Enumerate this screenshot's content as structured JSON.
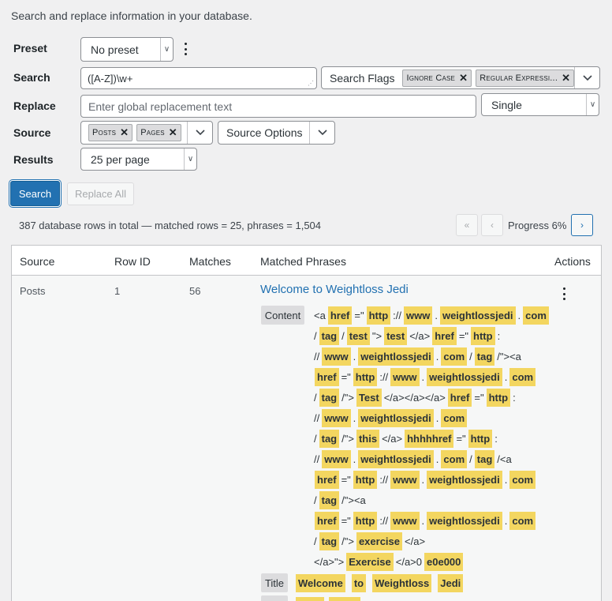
{
  "intro": "Search and replace information in your database.",
  "labels": {
    "preset": "Preset",
    "search": "Search",
    "replace": "Replace",
    "source": "Source",
    "results": "Results"
  },
  "preset": {
    "value": "No preset"
  },
  "search": {
    "value": "([A-Z])\\w+"
  },
  "search_flags": {
    "label": "Search Flags",
    "tags": [
      "Ignore Case",
      "Regular Expressi..."
    ]
  },
  "replace": {
    "placeholder": "Enter global replacement text",
    "mode": "Single"
  },
  "source": {
    "tags": [
      "Posts",
      "Pages"
    ],
    "options_label": "Source Options"
  },
  "results": {
    "value": "25 per page"
  },
  "buttons": {
    "search": "Search",
    "replace_all": "Replace All"
  },
  "summary": "387 database rows in total — matched rows = 25, phrases = 1,504",
  "pagination": {
    "first": "«",
    "prev": "‹",
    "progress": "Progress 6%",
    "next": "›"
  },
  "progress_percent": 6,
  "colors": {
    "primary": "#2271b1",
    "highlight": "#f3d660",
    "link": "#2271b1"
  },
  "table": {
    "headers": [
      "Source",
      "Row ID",
      "Matches",
      "Matched Phrases",
      "Actions"
    ],
    "rows": [
      {
        "source": "Posts",
        "row_id": "1",
        "matches": "56",
        "title": "Welcome to Weightloss Jedi",
        "content_label": "Content",
        "title_label": "Title",
        "content_lines": [
          [
            [
              "p",
              "<a"
            ],
            [
              "h",
              "href"
            ],
            [
              "p",
              "=\""
            ],
            [
              "h",
              "http"
            ],
            [
              "p",
              "://"
            ],
            [
              "h",
              "www"
            ],
            [
              "p",
              "."
            ],
            [
              "h",
              "weightlossjedi"
            ],
            [
              "p",
              "."
            ],
            [
              "h",
              "com"
            ]
          ],
          [
            [
              "p",
              "/"
            ],
            [
              "h",
              "tag"
            ],
            [
              "p",
              "/"
            ],
            [
              "h",
              "test"
            ],
            [
              "p",
              "\">"
            ],
            [
              "h",
              "test"
            ],
            [
              "p",
              "</a>"
            ],
            [
              "h",
              "href"
            ],
            [
              "p",
              "=\""
            ],
            [
              "h",
              "http"
            ],
            [
              "p",
              ":"
            ]
          ],
          [
            [
              "p",
              "//"
            ],
            [
              "h",
              "www"
            ],
            [
              "p",
              "."
            ],
            [
              "h",
              "weightlossjedi"
            ],
            [
              "p",
              "."
            ],
            [
              "h",
              "com"
            ],
            [
              "p",
              "/"
            ],
            [
              "h",
              "tag"
            ],
            [
              "p",
              "/\"><a"
            ]
          ],
          [
            [
              "h",
              "href"
            ],
            [
              "p",
              "=\""
            ],
            [
              "h",
              "http"
            ],
            [
              "p",
              "://"
            ],
            [
              "h",
              "www"
            ],
            [
              "p",
              "."
            ],
            [
              "h",
              "weightlossjedi"
            ],
            [
              "p",
              "."
            ],
            [
              "h",
              "com"
            ]
          ],
          [
            [
              "p",
              "/"
            ],
            [
              "h",
              "tag"
            ],
            [
              "p",
              "/\">"
            ],
            [
              "h",
              "Test"
            ],
            [
              "p",
              "</a></a></a>"
            ],
            [
              "h",
              "href"
            ],
            [
              "p",
              "=\""
            ],
            [
              "h",
              "http"
            ],
            [
              "p",
              ":"
            ]
          ],
          [
            [
              "p",
              "//"
            ],
            [
              "h",
              "www"
            ],
            [
              "p",
              "."
            ],
            [
              "h",
              "weightlossjedi"
            ],
            [
              "p",
              "."
            ],
            [
              "h",
              "com"
            ]
          ],
          [
            [
              "p",
              "/"
            ],
            [
              "h",
              "tag"
            ],
            [
              "p",
              "/\">"
            ],
            [
              "h",
              "this"
            ],
            [
              "p",
              "</a>"
            ],
            [
              "h",
              "hhhhhref"
            ],
            [
              "p",
              "=\""
            ],
            [
              "h",
              "http"
            ],
            [
              "p",
              ":"
            ]
          ],
          [
            [
              "p",
              "//"
            ],
            [
              "h",
              "www"
            ],
            [
              "p",
              "."
            ],
            [
              "h",
              "weightlossjedi"
            ],
            [
              "p",
              "."
            ],
            [
              "h",
              "com"
            ],
            [
              "p",
              "/"
            ],
            [
              "h",
              "tag"
            ],
            [
              "p",
              "/<a"
            ]
          ],
          [
            [
              "h",
              "href"
            ],
            [
              "p",
              "=\""
            ],
            [
              "h",
              "http"
            ],
            [
              "p",
              "://"
            ],
            [
              "h",
              "www"
            ],
            [
              "p",
              "."
            ],
            [
              "h",
              "weightlossjedi"
            ],
            [
              "p",
              "."
            ],
            [
              "h",
              "com"
            ]
          ],
          [
            [
              "p",
              "/"
            ],
            [
              "h",
              "tag"
            ],
            [
              "p",
              "/\"><a"
            ]
          ],
          [
            [
              "h",
              "href"
            ],
            [
              "p",
              "=\""
            ],
            [
              "h",
              "http"
            ],
            [
              "p",
              "://"
            ],
            [
              "h",
              "www"
            ],
            [
              "p",
              "."
            ],
            [
              "h",
              "weightlossjedi"
            ],
            [
              "p",
              "."
            ],
            [
              "h",
              "com"
            ]
          ],
          [
            [
              "p",
              "/"
            ],
            [
              "h",
              "tag"
            ],
            [
              "p",
              "/\">"
            ],
            [
              "h",
              "exercise"
            ],
            [
              "p",
              "</a>"
            ]
          ],
          [
            [
              "p",
              "</a>\">"
            ],
            [
              "h",
              "Exercise"
            ],
            [
              "p",
              "</a>0"
            ],
            [
              "h",
              "e0e000"
            ]
          ]
        ],
        "title_words": [
          "Welcome",
          "to",
          "Weightloss",
          "Jedi"
        ]
      }
    ]
  }
}
